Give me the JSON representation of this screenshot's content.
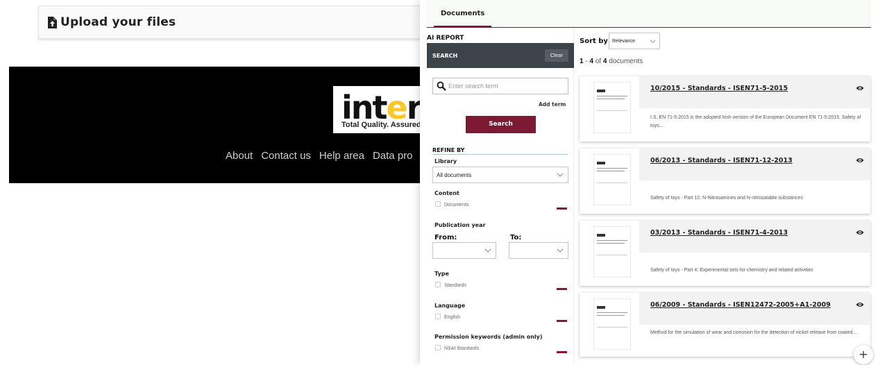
{
  "background": {
    "upload_title": "Upload your files",
    "logo": {
      "brand_pre": "int",
      "brand_dot": "e",
      "brand_post": "rtek",
      "tagline": "Total Quality. Assured."
    },
    "footer_links": [
      "About",
      "Contact us",
      "Help area",
      "Data pro"
    ]
  },
  "panel": {
    "tab": "Documents",
    "ai_report": "AI REPORT",
    "search_header": "SEARCH",
    "clear_label": "Clear",
    "search_placeholder": "Enter search term",
    "add_term": "Add term",
    "search_button": "Search",
    "refine_by": "REFINE BY",
    "library_label": "Library",
    "library_value": "All documents",
    "content_label": "Content",
    "content_option": "Documents",
    "pub_year_label": "Publication year",
    "from_label": "From:",
    "to_label": "To:",
    "type_label": "Type",
    "type_option": "Standards",
    "language_label": "Language",
    "language_option": "English",
    "permission_label": "Permission keywords (admin only)",
    "permission_option": "NSAI Standards"
  },
  "results": {
    "sort_label": "Sort by:",
    "sort_value": "Relevance",
    "count_from": "1",
    "count_to": "4",
    "count_sep": " - ",
    "count_of": " of ",
    "count_total": "4",
    "count_suffix": " documents",
    "items": [
      {
        "title": "10/2015 - Standards - ISEN71-5-2015",
        "description": "I.S. EN 71-5:2015 is the adopted Irish version of the European Document EN 71-5:2015, Safety of toys..."
      },
      {
        "title": "06/2013 - Standards - ISEN71-12-2013",
        "description": "Safety of toys - Part 12: N-Nitrosamines and N-nitrosatable substances"
      },
      {
        "title": "03/2013 - Standards - ISEN71-4-2013",
        "description": "Safety of toys - Part 4: Experimental sets for chemistry and related activities"
      },
      {
        "title": "06/2009 - Standards - ISEN12472-2005+A1-2009",
        "description": "Method for the simulation of wear and corrosion for the detection of nickel release from coated..."
      }
    ]
  },
  "fab_label": "+",
  "colors": {
    "accent": "#8a1538",
    "search_button": "#7b1a32",
    "search_header": "#3d4449",
    "logo_dot": "#ffc72c"
  },
  "icons": [
    "file-upload-icon",
    "search-icon",
    "chevron-down-icon",
    "eye-icon",
    "plus-icon"
  ]
}
